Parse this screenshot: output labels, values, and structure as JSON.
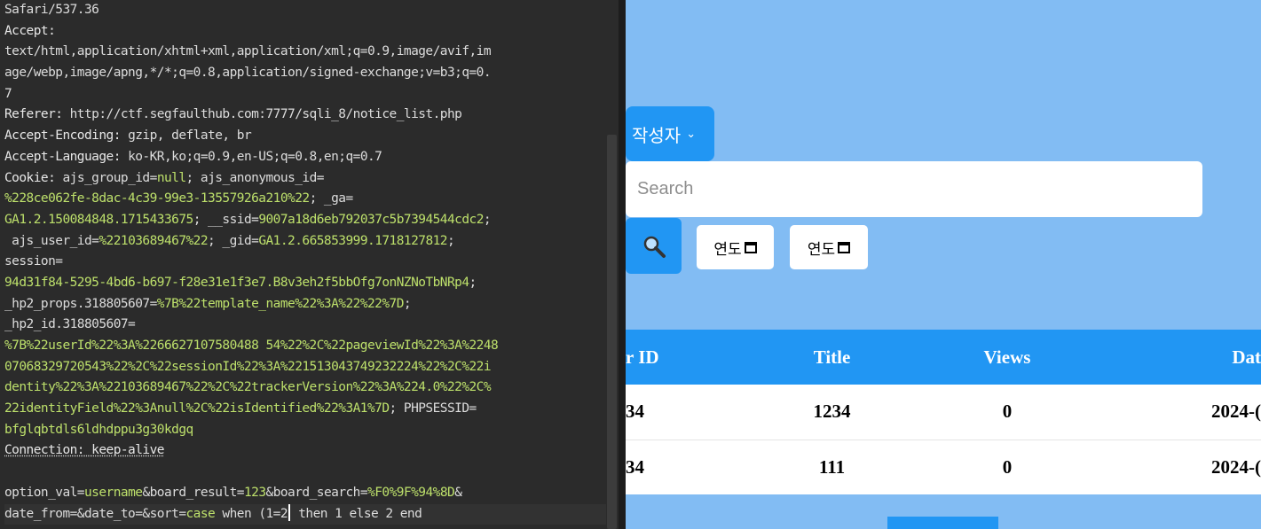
{
  "editor": {
    "lines": [
      [
        {
          "t": "Safari/537.36",
          "c": "v"
        }
      ],
      [
        {
          "t": "Accept:",
          "c": "k"
        }
      ],
      [
        {
          "t": "text/html,application/xhtml+xml,application/xml;q=0.9,image/avif,im",
          "c": "v"
        }
      ],
      [
        {
          "t": "age/webp,image/apng,*/*;q=0.8,application/signed-exchange;v=b3;q=0.",
          "c": "v"
        }
      ],
      [
        {
          "t": "7",
          "c": "v"
        }
      ],
      [
        {
          "t": "Referer: ",
          "c": "k"
        },
        {
          "t": "http://ctf.segfaulthub.com:7777/sqli_8/notice_list.php",
          "c": "v"
        }
      ],
      [
        {
          "t": "Accept-Encoding: ",
          "c": "k"
        },
        {
          "t": "gzip, deflate, br",
          "c": "v"
        }
      ],
      [
        {
          "t": "Accept-Language: ",
          "c": "k"
        },
        {
          "t": "ko-KR,ko;q=0.9,en-US;q=0.8,en;q=0.7",
          "c": "v"
        }
      ],
      [
        {
          "t": "Cookie: ",
          "c": "k"
        },
        {
          "t": "ajs_group_id",
          "c": "v"
        },
        {
          "t": "=",
          "c": "v"
        },
        {
          "t": "null",
          "c": "g"
        },
        {
          "t": "; ajs_anonymous_id=",
          "c": "v"
        }
      ],
      [
        {
          "t": "%228ce062fe-8dac-4c39-99e3-13557926a210%22",
          "c": "g"
        },
        {
          "t": "; _ga=",
          "c": "v"
        }
      ],
      [
        {
          "t": "GA1.2.150084848.1715433675",
          "c": "g"
        },
        {
          "t": "; __ssid=",
          "c": "v"
        },
        {
          "t": "9007a18d6eb792037c5b7394544cdc2",
          "c": "g"
        },
        {
          "t": ";",
          "c": "v"
        }
      ],
      [
        {
          "t": " ajs_user_id=",
          "c": "v"
        },
        {
          "t": "%22103689467%22",
          "c": "g"
        },
        {
          "t": "; _gid=",
          "c": "v"
        },
        {
          "t": "GA1.2.665853999.1718127812",
          "c": "g"
        },
        {
          "t": ";",
          "c": "v"
        }
      ],
      [
        {
          "t": "session=",
          "c": "v"
        }
      ],
      [
        {
          "t": "94d31f84-5295-4bd6-b697-f28e31e1f3e7.B8v3eh2f5bbOfg7onNZNoTbNRp4",
          "c": "g"
        },
        {
          "t": ";",
          "c": "v"
        }
      ],
      [
        {
          "t": "_hp2_props.318805607=",
          "c": "v"
        },
        {
          "t": "%7B%22template_name%22%3A%22%22%7D",
          "c": "g"
        },
        {
          "t": ";",
          "c": "v"
        }
      ],
      [
        {
          "t": "_hp2_id.318805607=",
          "c": "v"
        }
      ],
      [
        {
          "t": "%7B%22userId%22%3A%2266627107580488 54%22%2C%22pageviewId%22%3A%2248",
          "c": "g"
        }
      ],
      [
        {
          "t": "07068329720543%22%2C%22sessionId%22%3A%221513043749232224%22%2C%22i",
          "c": "g"
        }
      ],
      [
        {
          "t": "dentity%22%3A%22103689467%22%2C%22trackerVersion%22%3A%224.0%22%2C%",
          "c": "g"
        }
      ],
      [
        {
          "t": "22identityField%22%3Anull%2C%22isIdentified%22%3A1%7D",
          "c": "g"
        },
        {
          "t": "; PHPSESSID=",
          "c": "v"
        }
      ],
      [
        {
          "t": "bfglqbtdls6ldhdppu3g30kdgq",
          "c": "g"
        }
      ],
      [
        {
          "t": "Connection: keep-alive",
          "c": "k u"
        }
      ],
      [
        {
          "t": "",
          "c": "v"
        }
      ],
      [
        {
          "t": "option_val=",
          "c": "v"
        },
        {
          "t": "username",
          "c": "g"
        },
        {
          "t": "&board_result=",
          "c": "v"
        },
        {
          "t": "123",
          "c": "g"
        },
        {
          "t": "&board_search=",
          "c": "v"
        },
        {
          "t": "%F0%9F%94%8D",
          "c": "g"
        },
        {
          "t": "&",
          "c": "v"
        }
      ],
      [
        {
          "t": "date_from=&date_to=&sort=",
          "c": "v"
        },
        {
          "t": "case",
          "c": "g"
        },
        {
          "t": " when (1=2",
          "c": "v"
        },
        {
          "t": "|",
          "c": "cursor"
        },
        {
          "t": " then 1 else 2 end",
          "c": "v"
        }
      ]
    ]
  },
  "web": {
    "author_select_label": "작성자",
    "author_select_chevron": "⌄",
    "search_placeholder": "Search",
    "search_icon": "magnifier-icon",
    "date_from_text": "연도",
    "date_to_text": "연도",
    "table": {
      "headers": [
        "r ID",
        "Title",
        "Views",
        "Dat"
      ],
      "rows": [
        [
          "34",
          "1234",
          "0",
          "2024-("
        ],
        [
          "34",
          "111",
          "0",
          "2024-("
        ]
      ]
    },
    "colors": {
      "page_bg": "#82bcf3",
      "accent": "#2196f3"
    }
  }
}
